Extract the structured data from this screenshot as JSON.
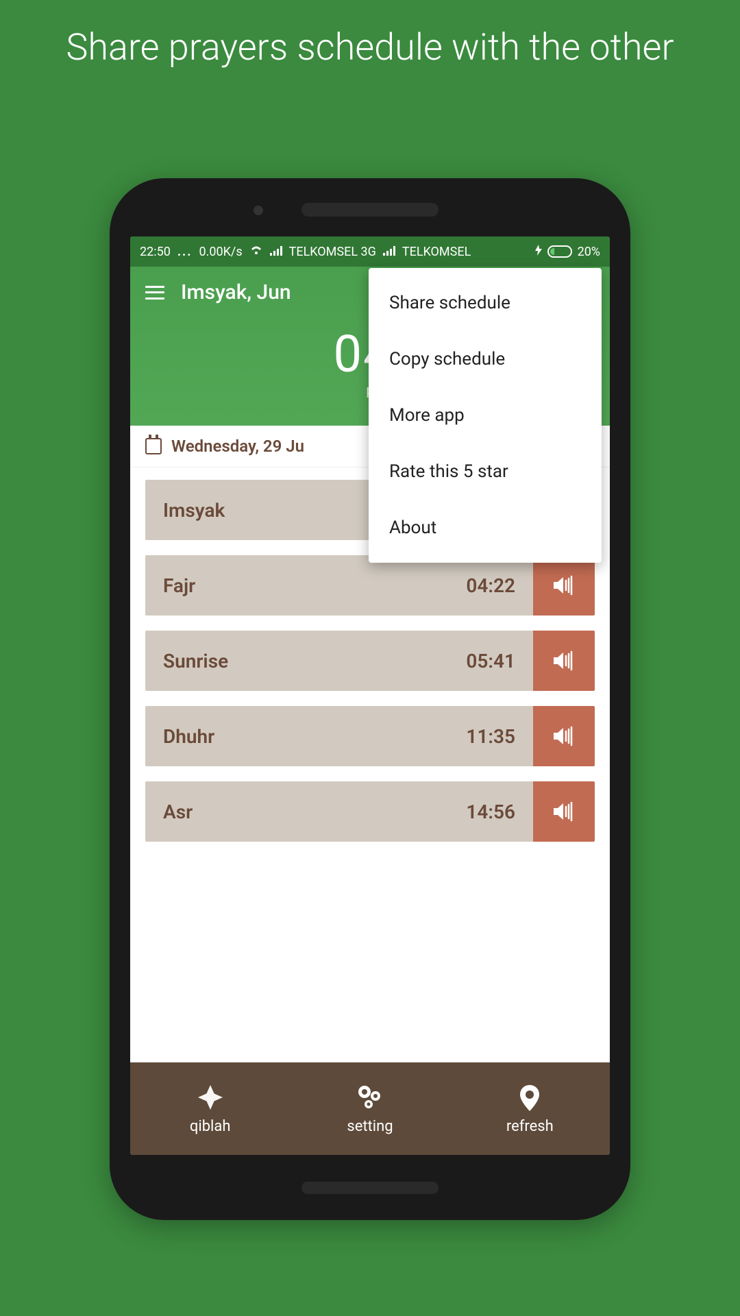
{
  "promo": {
    "title": "Share prayers schedule with the other"
  },
  "status_bar": {
    "time": "22:50",
    "data_rate": "0.00K/s",
    "carrier1": "TELKOMSEL 3G",
    "carrier2": "TELKOMSEL",
    "battery_pct": "20%"
  },
  "header": {
    "title": "Imsyak, Jun",
    "big_time": "04:",
    "big_time_sub": "p"
  },
  "date_bar": {
    "date": "Wednesday, 29 Ju"
  },
  "prayers": [
    {
      "name": "Imsyak",
      "time": ""
    },
    {
      "name": "Fajr",
      "time": "04:22"
    },
    {
      "name": "Sunrise",
      "time": "05:41"
    },
    {
      "name": "Dhuhr",
      "time": "11:35"
    },
    {
      "name": "Asr",
      "time": "14:56"
    }
  ],
  "bottom_nav": {
    "items": [
      {
        "label": "qiblah"
      },
      {
        "label": "setting"
      },
      {
        "label": "refresh"
      }
    ]
  },
  "menu": {
    "items": [
      "Share schedule",
      "Copy schedule",
      "More app",
      "Rate this 5 star",
      "About"
    ]
  }
}
